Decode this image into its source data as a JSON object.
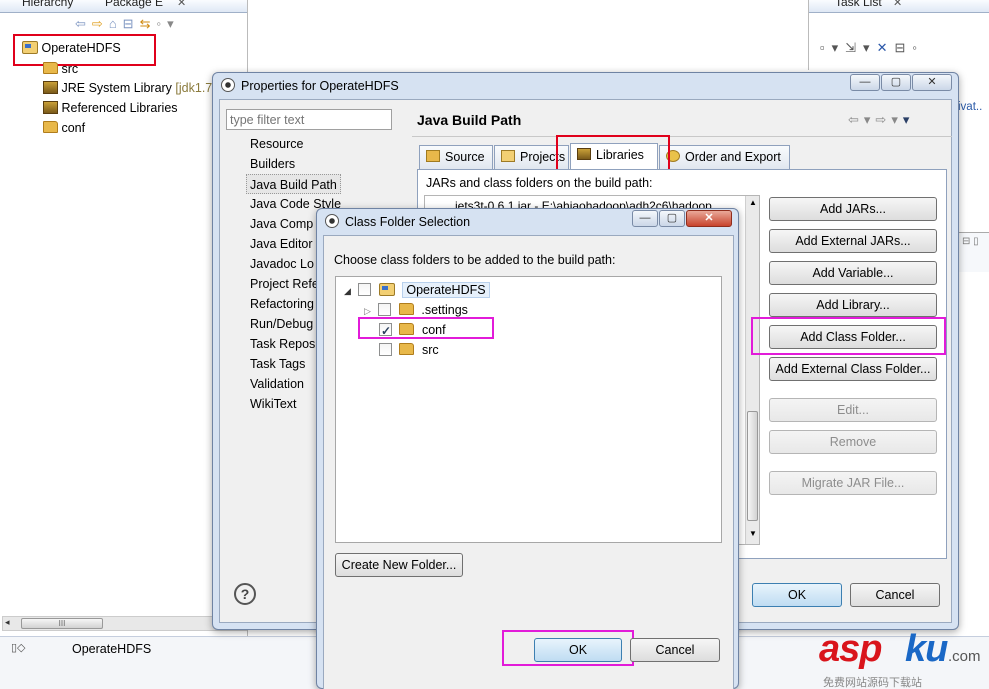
{
  "background": {
    "view_tabs": [
      "Hierarchy",
      "Package E"
    ],
    "task_tab": "Task List",
    "tree": [
      {
        "label": "OperateHDFS",
        "icon": "project-icon"
      },
      {
        "label": "src",
        "icon": "package-folder-icon"
      },
      {
        "label": "JRE System Library",
        "suffix": "[jdk1.7",
        "icon": "library-icon"
      },
      {
        "label": "Referenced Libraries",
        "icon": "library-icon"
      },
      {
        "label": "conf",
        "icon": "folder-icon"
      }
    ],
    "status_bar_project": "OperateHDFS",
    "status_left_symbol": "▯◇",
    "right_edge_fragment": "ivat..",
    "scrollbar_marker": "III"
  },
  "properties_dialog": {
    "title": "Properties for OperateHDFS",
    "filter_placeholder": "type filter text",
    "nav_items": [
      "Resource",
      "Builders",
      "Java Build Path",
      "Java Code Style",
      "Java Comp",
      "Java Editor",
      "Javadoc Lo",
      "Project Refe",
      "Refactoring",
      "Run/Debug",
      "Task Repos",
      "Task Tags",
      "Validation",
      "WikiText"
    ],
    "selected_nav": "Java Build Path",
    "page_title": "Java Build Path",
    "tabs": [
      "Source",
      "Projects",
      "Libraries",
      "Order and Export"
    ],
    "selected_tab": "Libraries",
    "jars_label": "JARs and class folders on the build path:",
    "jar_entry_fragment": "jets3t-0.6.1.jar - E:\\ahiaohadoop\\adh2c6\\hadoop",
    "buttons": {
      "add_jars": "Add JARs...",
      "add_external_jars": "Add External JARs...",
      "add_variable": "Add Variable...",
      "add_library": "Add Library...",
      "add_class_folder": "Add Class Folder...",
      "add_external_class_folder": "Add External Class Folder...",
      "edit": "Edit...",
      "remove": "Remove",
      "migrate_jar": "Migrate JAR File...",
      "ok": "OK",
      "cancel": "Cancel"
    },
    "help_symbol": "?"
  },
  "class_folder_dialog": {
    "title": "Class Folder Selection",
    "prompt": "Choose class folders to be added to the build path:",
    "tree": [
      {
        "label": "OperateHDFS",
        "checked": false,
        "expanded": true,
        "level": 0
      },
      {
        "label": ".settings",
        "checked": false,
        "expanded": false,
        "level": 1
      },
      {
        "label": "conf",
        "checked": true,
        "level": 1
      },
      {
        "label": "src",
        "checked": false,
        "level": 1
      }
    ],
    "create_folder_button": "Create New Folder...",
    "ok": "OK",
    "cancel": "Cancel"
  },
  "watermark": {
    "brand_red": "asp",
    "brand_blue": "ku",
    "suffix": ".com",
    "subtitle": "免费网站源码下载站"
  },
  "colors": {
    "highlight_red": "#e0001b",
    "highlight_magenta": "#e21bd9",
    "selection": "#cde8ff"
  }
}
